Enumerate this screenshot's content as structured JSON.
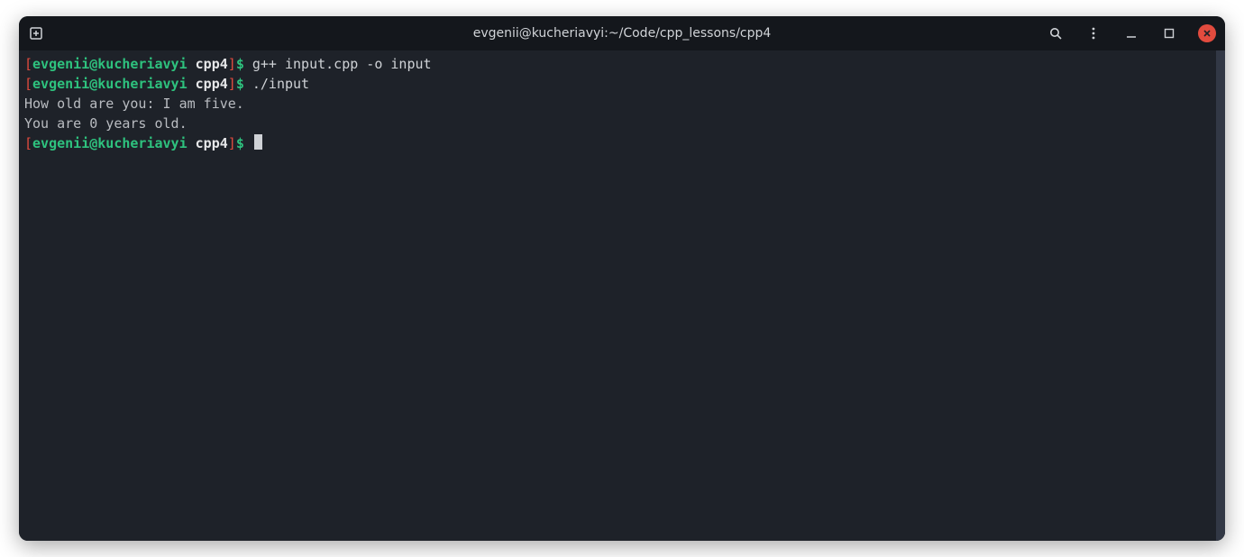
{
  "titlebar": {
    "title": "evgenii@kucheriavyi:~/Code/cpp_lessons/cpp4"
  },
  "prompt": {
    "open_bracket": "[",
    "close_bracket": "]",
    "userhost": "evgenii@kucheriavyi",
    "dir": "cpp4",
    "symbol": "$"
  },
  "lines": {
    "cmd1": "g++ input.cpp -o input",
    "cmd2": "./input",
    "out1": "How old are you: I am five.",
    "out2": "You are 0 years old."
  },
  "icons": {
    "newtab": "new-tab-icon",
    "search": "search-icon",
    "menu": "menu-icon",
    "minimize": "minimize-icon",
    "maximize": "maximize-icon",
    "close": "close-icon"
  }
}
